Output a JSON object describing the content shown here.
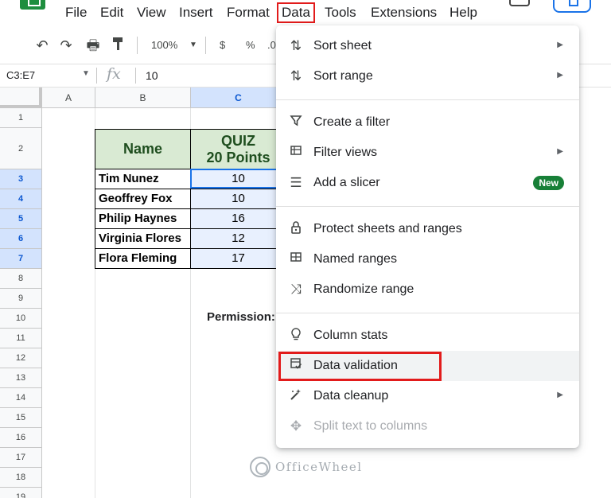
{
  "menubar": {
    "items": [
      "File",
      "Edit",
      "View",
      "Insert",
      "Format",
      "Data",
      "Tools",
      "Extensions",
      "Help"
    ],
    "active": "Data"
  },
  "toolbar": {
    "zoom": "100%",
    "currency": "$",
    "percent": "%",
    "decimal_partial": ".0"
  },
  "formula_bar": {
    "name_box": "C3:E7",
    "fx": "fx",
    "value": "10"
  },
  "sheet": {
    "columns": [
      "A",
      "B",
      "C"
    ],
    "rows": [
      "1",
      "2",
      "3",
      "4",
      "5",
      "6",
      "7",
      "8",
      "9",
      "10",
      "11",
      "12",
      "13",
      "14",
      "15",
      "16",
      "17",
      "18",
      "19"
    ],
    "header": {
      "name": "Name",
      "quiz_line1": "QUIZ",
      "quiz_line2": "20 Points"
    },
    "data": [
      {
        "name": "Tim Nunez",
        "score": "10"
      },
      {
        "name": "Geoffrey Fox",
        "score": "10"
      },
      {
        "name": "Philip Haynes",
        "score": "16"
      },
      {
        "name": "Virginia Flores",
        "score": "12"
      },
      {
        "name": "Flora Fleming",
        "score": "17"
      }
    ],
    "permission_label": "Permission:"
  },
  "data_menu": {
    "sort_sheet": "Sort sheet",
    "sort_range": "Sort range",
    "create_filter": "Create a filter",
    "filter_views": "Filter views",
    "add_slicer": "Add a slicer",
    "new_badge": "New",
    "protect": "Protect sheets and ranges",
    "named_ranges": "Named ranges",
    "randomize": "Randomize range",
    "column_stats": "Column stats",
    "data_validation": "Data validation",
    "data_cleanup": "Data cleanup",
    "split_text": "Split text to columns"
  },
  "watermark": "OfficeWheel",
  "colors": {
    "highlight_red": "#e21b1b",
    "header_fill": "#d9ead3",
    "selection_blue": "#1a73e8",
    "new_badge_green": "#188038"
  }
}
